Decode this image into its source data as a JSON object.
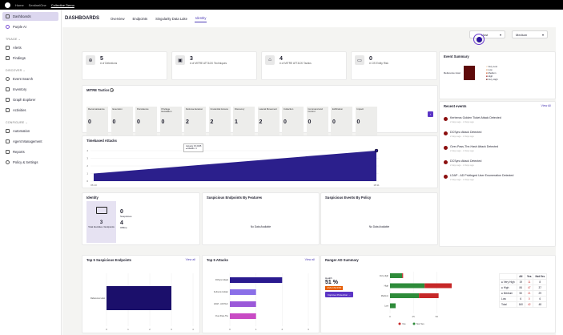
{
  "topbar": {
    "crumbs": [
      "Home",
      "SentinelOne",
      "Collective Demo"
    ]
  },
  "sidebar": {
    "items_top": [
      {
        "label": "Dashboards",
        "icon": "dashboard-icon",
        "active": true
      },
      {
        "label": "Purple AI",
        "icon": "sparkle-icon"
      }
    ],
    "sections": [
      {
        "title": "TRIAGE",
        "items": [
          {
            "label": "Alerts",
            "icon": "bell-icon"
          },
          {
            "label": "Findings",
            "icon": "findings-icon"
          }
        ]
      },
      {
        "title": "DISCOVER",
        "items": [
          {
            "label": "Event Search",
            "icon": "search-icon"
          },
          {
            "label": "Inventory",
            "icon": "inventory-icon"
          },
          {
            "label": "Graph Explorer",
            "icon": "graph-icon"
          },
          {
            "label": "Activities",
            "icon": "activity-icon"
          }
        ]
      },
      {
        "title": "CONFIGURE",
        "items": [
          {
            "label": "Automation",
            "icon": "automation-icon"
          },
          {
            "label": "Agent Management",
            "icon": "agent-icon"
          },
          {
            "label": "Reports",
            "icon": "report-icon"
          },
          {
            "label": "Policy & Settings",
            "icon": "gear-icon"
          }
        ]
      }
    ]
  },
  "header": {
    "title": "DASHBOARDS",
    "tabs": [
      "Overview",
      "Endpoints",
      "Singularity Data Lake",
      "Identity"
    ],
    "active_tab": "Identity"
  },
  "filters": {
    "left": "Host",
    "right": "Medium"
  },
  "stats": [
    {
      "value": "5",
      "label": "# of Detections"
    },
    {
      "value": "3",
      "label": "# of MITRE ATT&CK Techniques"
    },
    {
      "value": "4",
      "label": "# of MITRE ATT&CK Tactics"
    },
    {
      "value": "0",
      "label": "# CIS Entity Risk"
    }
  ],
  "event_summary": {
    "title": "Event Summary",
    "row_label": "Reference Host",
    "legend": [
      "Very Low",
      "Low",
      "Medium",
      "High",
      "Very High"
    ],
    "colors": [
      "#f2d6b8",
      "#e7a66b",
      "#d05a2b",
      "#a71d1d",
      "#5e0a0a"
    ]
  },
  "mitre": {
    "title": "MITRE Tactics",
    "tactics": [
      {
        "name": "Reconnaissance",
        "value": "0"
      },
      {
        "name": "Execution",
        "value": "0"
      },
      {
        "name": "Persistence",
        "value": "0"
      },
      {
        "name": "Privilege Escalation",
        "value": "0"
      },
      {
        "name": "Defense Evasion",
        "value": "2"
      },
      {
        "name": "Credential Access",
        "value": "2"
      },
      {
        "name": "Discovery",
        "value": "1"
      },
      {
        "name": "Lateral Movement",
        "value": "2"
      },
      {
        "name": "Collection",
        "value": "0"
      },
      {
        "name": "Command and Control",
        "value": "0"
      },
      {
        "name": "Exfiltration",
        "value": "0"
      },
      {
        "name": "Impact",
        "value": "0"
      }
    ]
  },
  "recent_events": {
    "title": "Recent events",
    "view_all": "View All",
    "items": [
      {
        "title": "Kerberos Golden Ticket Attack Detected",
        "sub": "2 days ago · 2 days ago"
      },
      {
        "title": "DCSync Attack Detected",
        "sub": "2 days ago · 2 days ago"
      },
      {
        "title": "Over-Pass-The-Hash Attack Detected",
        "sub": "2 days ago · 2 days ago"
      },
      {
        "title": "DCSync Attack Detected",
        "sub": "2 days ago · 2 days ago"
      },
      {
        "title": "LDAP - AD Privileged User Enumeration Detected",
        "sub": "2 days ago · 2 days ago"
      }
    ]
  },
  "timeline": {
    "title": "Timebased Attacks",
    "tooltip_title": "January 15 2025",
    "tooltip_value": "● Attacks: 4",
    "chart_data": {
      "type": "area",
      "x": [
        "06:10",
        "18:11"
      ],
      "y": [
        1,
        4
      ],
      "ylim": [
        0,
        4
      ],
      "yticks": [
        0,
        1,
        2,
        3,
        4
      ]
    }
  },
  "identity": {
    "title": "Identity",
    "total_label": "Total Identities / Endpoints",
    "total_value": "3",
    "suspicious_value": "0",
    "suspicious_label": "Suspicious",
    "offline_value": "4",
    "offline_label": "Offline"
  },
  "suspicious_endpoints": {
    "title": "Suspicious Endpoints By Features",
    "empty": "No Data Available"
  },
  "suspicious_events": {
    "title": "Suspicious Events By Policy",
    "empty": "No Data Available"
  },
  "top5_endpoints": {
    "title": "Top 5 Suspicious Endpoints",
    "view_all": "View all",
    "chart_data": {
      "type": "bar",
      "categories": [
        "Reference Host"
      ],
      "values": [
        3
      ],
      "xticks": [
        0,
        1,
        2,
        3,
        4
      ],
      "color": "#1b0f6b"
    }
  },
  "top5_attacks": {
    "title": "Top 5 Attacks",
    "view_all": "View all",
    "chart_data": {
      "type": "bar",
      "categories": [
        "DCSync Attack",
        "Kerberos Golden",
        "LDAP - AD Privil.",
        "Over-Pass-The"
      ],
      "values": [
        2,
        1,
        1,
        1
      ],
      "colors": [
        "#2a1a8f",
        "#8a6fe8",
        "#9b59d9",
        "#c84bc4"
      ],
      "xticks": [
        0,
        1,
        2,
        3
      ]
    }
  },
  "ranger": {
    "title": "Ranger AD Summary",
    "health_label": "Health",
    "health_value": "51 %",
    "grade": "ANALYZE RISK",
    "improve": "Improve Protection →",
    "chart_data": {
      "type": "bar",
      "categories": [
        "Very High",
        "High",
        "Medium",
        "Low"
      ],
      "series": [
        {
          "name": "Yes",
          "values": [
            1,
            47,
            21,
            0
          ],
          "color": "#c62828"
        },
        {
          "name": "Not Yes",
          "values": [
            13,
            37,
            31,
            6
          ],
          "color": "#2e8b3a"
        }
      ],
      "xticks": [
        0,
        25,
        50
      ]
    },
    "table": {
      "headers": [
        "",
        "All",
        "Yes",
        "Not Yes"
      ],
      "rows": [
        [
          "● Very High",
          "19",
          "11",
          "8"
        ],
        [
          "● High",
          "84",
          "47",
          "37"
        ],
        [
          "● Medium",
          "50",
          "21",
          "29"
        ],
        [
          "Low",
          "6",
          "0",
          "6"
        ],
        [
          "Total",
          "160",
          "42",
          "48"
        ]
      ]
    }
  }
}
